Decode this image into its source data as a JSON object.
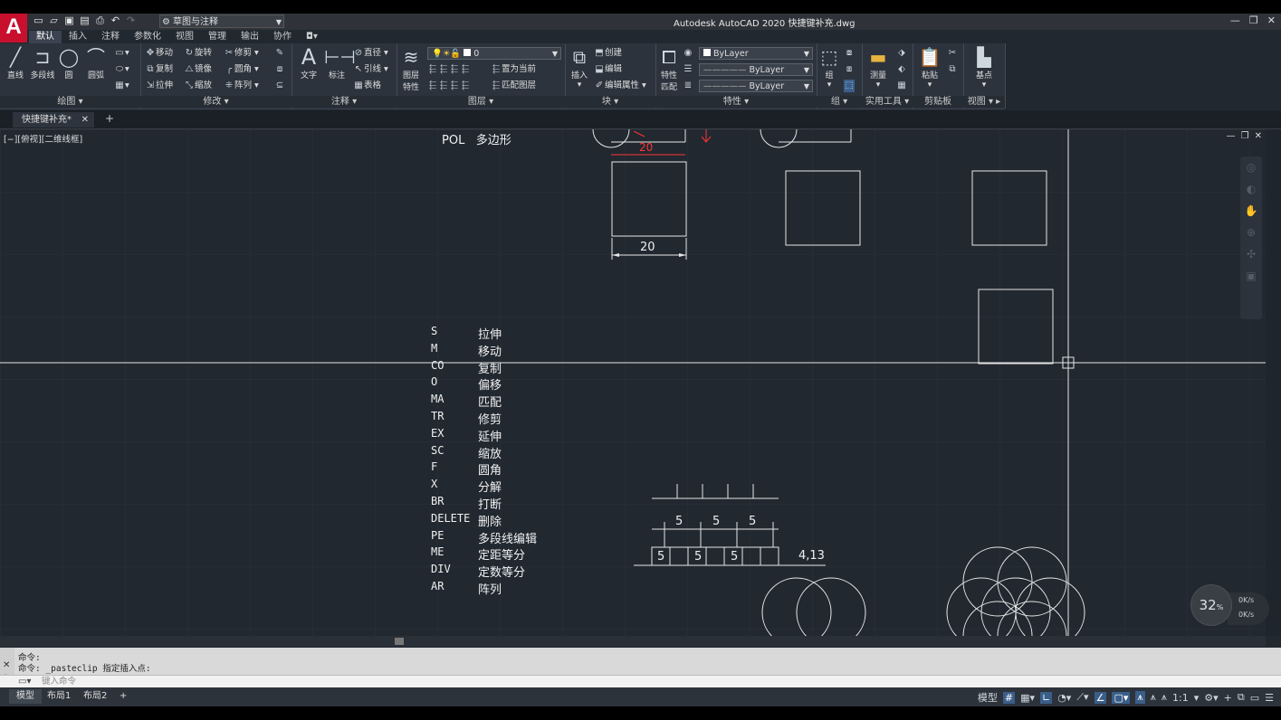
{
  "app": {
    "title": "Autodesk AutoCAD 2020    快捷键补充.dwg",
    "logo": "A",
    "workspace": "草图与注释",
    "ribbon_tabs": [
      "默认",
      "插入",
      "注释",
      "参数化",
      "视图",
      "管理",
      "输出",
      "协作"
    ],
    "active_tab": 0
  },
  "ribbon": {
    "draw": {
      "title": "绘图",
      "line": "直线",
      "polyline": "多段线",
      "circle": "圆",
      "arc": "圆弧"
    },
    "modify": {
      "title": "修改",
      "move": "移动",
      "rotate": "旋转",
      "trim": "修剪",
      "copy": "复制",
      "mirror": "镜像",
      "fillet": "圆角",
      "stretch": "拉伸",
      "scale": "缩放",
      "array": "阵列"
    },
    "annotation": {
      "title": "注释",
      "text": "文字",
      "dimension": "标注",
      "linear": "直径",
      "leader": "引线",
      "table": "表格"
    },
    "layers": {
      "title": "图层",
      "layer_props_1": "图层",
      "layer_props_2": "特性",
      "current_layer": "0",
      "make_current": "置为当前",
      "match_layer": "匹配图层"
    },
    "block": {
      "title": "块",
      "insert": "插入",
      "create": "创建",
      "edit": "编辑",
      "edit_attr": "编辑属性"
    },
    "properties": {
      "title": "特性",
      "match_1": "特性",
      "match_2": "匹配",
      "color": "ByLayer",
      "linetype": "ByLayer",
      "lineweight": "ByLayer"
    },
    "groups": {
      "title": "组",
      "group": "组"
    },
    "utilities": {
      "title": "实用工具",
      "measure": "测量"
    },
    "clipboard": {
      "title": "剪贴板",
      "paste": "粘贴"
    },
    "view": {
      "title": "视图",
      "base": "基点"
    }
  },
  "document_tab": "快捷键补充*",
  "viewport_label": "[−][俯视][二维线框]",
  "drawing": {
    "pol_label": "POL   多边形",
    "dim_top": "20",
    "dim_bottom": "20",
    "shortcuts": [
      {
        "key": "S",
        "desc": "拉伸"
      },
      {
        "key": "M",
        "desc": "移动"
      },
      {
        "key": "CO",
        "desc": "复制"
      },
      {
        "key": "O",
        "desc": "偏移"
      },
      {
        "key": "MA",
        "desc": "匹配"
      },
      {
        "key": "TR",
        "desc": "修剪"
      },
      {
        "key": "EX",
        "desc": "延伸"
      },
      {
        "key": "SC",
        "desc": "缩放"
      },
      {
        "key": "F",
        "desc": "圆角"
      },
      {
        "key": "X",
        "desc": "分解"
      },
      {
        "key": "BR",
        "desc": "打断"
      },
      {
        "key": "DELETE",
        "desc": "删除"
      },
      {
        "key": "PE",
        "desc": "多段线编辑"
      },
      {
        "key": "ME",
        "desc": "定距等分"
      },
      {
        "key": "DIV",
        "desc": "定数等分"
      },
      {
        "key": "AR",
        "desc": "阵列"
      }
    ],
    "measure_top": [
      "5",
      "5",
      "5"
    ],
    "measure_bottom": [
      "5",
      "5",
      "5"
    ],
    "measure_rest": "4,13"
  },
  "command": {
    "line1": "命令:",
    "line2": "命令: _pasteclip 指定插入点:",
    "placeholder": "键入命令"
  },
  "layout_tabs": [
    "模型",
    "布局1",
    "布局2"
  ],
  "status": {
    "model": "模型",
    "scale": "1:1"
  },
  "perf": {
    "cpu": "32",
    "cpu_unit": "%",
    "up": "0K/s",
    "down": "0K/s"
  }
}
